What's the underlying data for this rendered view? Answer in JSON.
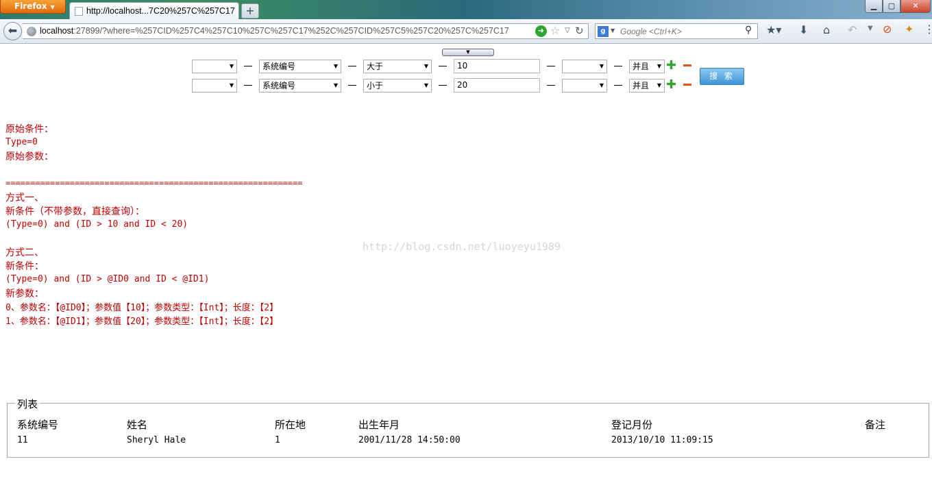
{
  "browser": {
    "app_button": "Firefox",
    "tab_title": "http://localhost...7C20%257C%257C17",
    "url_host": "localhost",
    "url_rest": ":27899/?where=%257CID%257C4%257C10%257C%257C17%252C%257CID%257C5%257C20%257C%257C17",
    "search_placeholder": "Google <Ctrl+K>"
  },
  "filters": {
    "rows": [
      {
        "field": "系统编号",
        "operator": "大于",
        "value": "10",
        "logic": "并且"
      },
      {
        "field": "系统编号",
        "operator": "小于",
        "value": "20",
        "logic": "并且"
      }
    ],
    "search_label": "搜 索"
  },
  "output": {
    "orig_cond_label": "原始条件：",
    "orig_cond_value": "Type=0",
    "orig_params_label": "原始参数：",
    "separator": "============================================================",
    "method1_title": "方式一、",
    "method1_label": "新条件（不带参数，直接查询）：",
    "method1_value": "(Type=0) and (ID > 10 and ID < 20)",
    "method2_title": "方式二、",
    "method2_cond_label": "新条件：",
    "method2_cond_value": "(Type=0) and (ID > @ID0 and ID < @ID1)",
    "method2_params_label": "新参数：",
    "param0": "0、参数名：【@ID0】；参数值【10】；参数类型：【Int】；长度：【2】",
    "param1": "1、参数名：【@ID1】；参数值【20】；参数类型：【Int】；长度：【2】"
  },
  "watermark": "http://blog.csdn.net/luoyeyu1989",
  "list": {
    "legend": "列表",
    "headers": [
      "系统编号",
      "姓名",
      "所在地",
      "出生年月",
      "登记月份",
      "备注"
    ],
    "rows": [
      [
        "11",
        "Sheryl Hale",
        "1",
        "2001/11/28 14:50:00",
        "2013/10/10 11:09:15",
        ""
      ]
    ]
  },
  "colors": {
    "output_text": "#c00000",
    "add_icon": "#3aa335",
    "remove_icon": "#e0561a",
    "search_button": "#3e95d8"
  }
}
